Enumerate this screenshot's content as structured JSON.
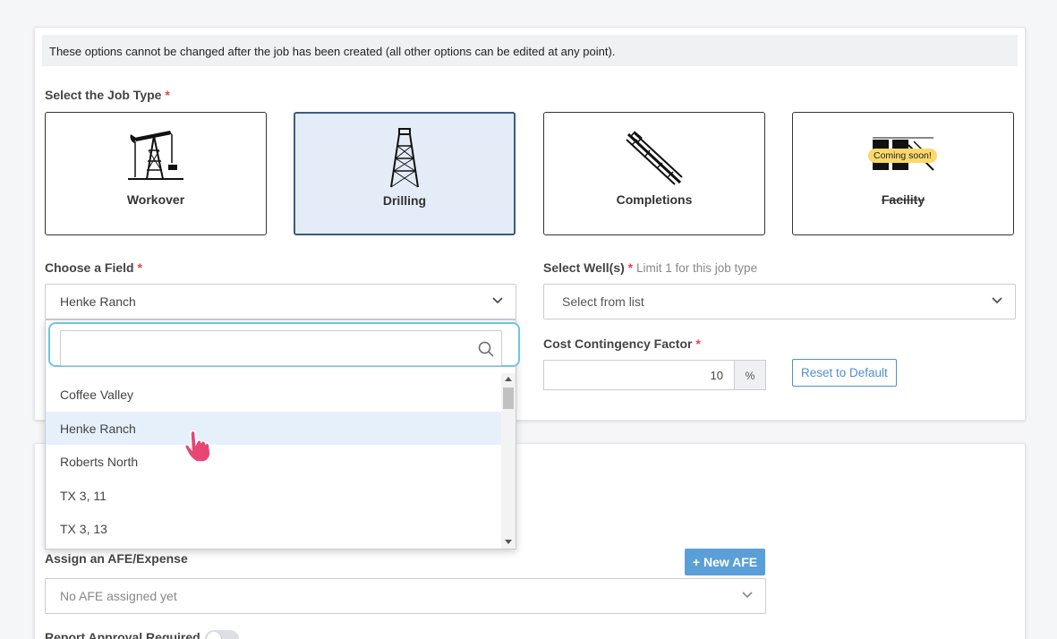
{
  "notice": "These options cannot be changed after the job has been created (all other options can be edited at any point).",
  "job_type": {
    "label": "Select the Job Type",
    "required_mark": "*",
    "options": [
      {
        "name": "Workover",
        "icon": "pumpjack-icon"
      },
      {
        "name": "Drilling",
        "icon": "drilling-rig-icon",
        "selected": true
      },
      {
        "name": "Completions",
        "icon": "completions-pipes-icon"
      },
      {
        "name": "Facility",
        "icon": "facility-icon",
        "badge": "Coming soon!",
        "disabled": true
      }
    ]
  },
  "field": {
    "label": "Choose a Field",
    "required_mark": "*",
    "value": "Henke Ranch",
    "search_value": "",
    "options": [
      "Coffee Valley",
      "Henke Ranch",
      "Roberts North",
      "TX 3, 11",
      "TX 3, 13"
    ],
    "hovered": "Henke Ranch"
  },
  "wells": {
    "label": "Select Well(s)",
    "required_mark": "*",
    "hint": "Limit 1 for this job type",
    "placeholder": "Select from list"
  },
  "contingency": {
    "label": "Cost Contingency Factor",
    "required_mark": "*",
    "value": "10",
    "unit": "%",
    "reset_label": "Reset to Default"
  },
  "afe": {
    "label": "Assign an AFE/Expense",
    "new_label": "New AFE",
    "new_icon": "plus-icon",
    "placeholder": "No AFE assigned yet"
  },
  "approval": {
    "label": "Report Approval Required",
    "enabled": false
  },
  "colors": {
    "accent": "#5b9fd8",
    "required": "#e0474c",
    "selected_bg": "#e4ecf7",
    "focus_ring": "#6cc7e0",
    "badge": "#fcd86b"
  }
}
